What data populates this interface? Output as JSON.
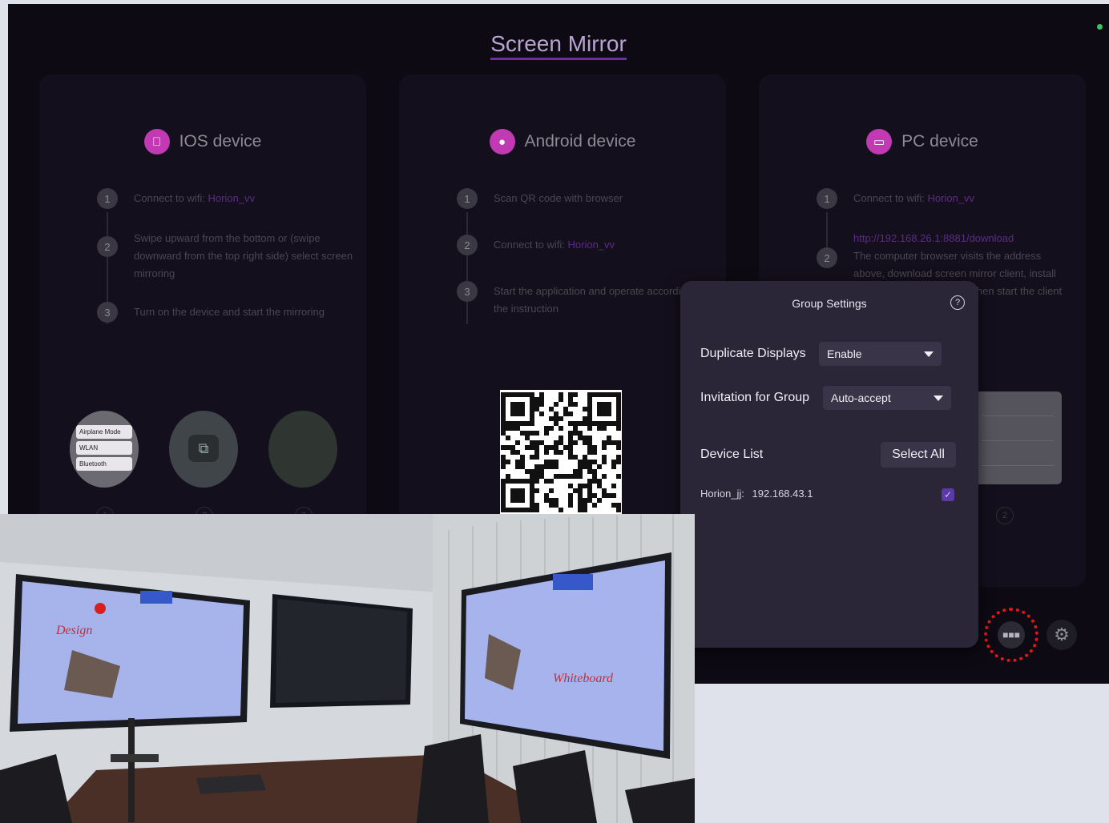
{
  "screen": {
    "title": "Screen Mirror",
    "columns": [
      {
        "name": "IOS device",
        "icon": "apple-icon",
        "steps": [
          {
            "num": "1",
            "text": "Connect to wifi:",
            "wifi": "Horion_vv"
          },
          {
            "num": "2",
            "text": "Swipe upward from the bottom or (swipe downward from the top right side) select screen mirroring"
          },
          {
            "num": "3",
            "text": "Turn on the device and start the mirroring"
          }
        ],
        "thumb_nums": [
          "1",
          "2",
          "3"
        ]
      },
      {
        "name": "Android device",
        "icon": "android-icon",
        "steps": [
          {
            "num": "1",
            "text": "Scan QR code with browser"
          },
          {
            "num": "2",
            "text": "Connect to wifi:",
            "wifi": "Horion_vv"
          },
          {
            "num": "3",
            "text": "Start the application and operate according to the instruction"
          }
        ]
      },
      {
        "name": "PC device",
        "icon": "monitor-icon",
        "steps": [
          {
            "num": "1",
            "text": "Connect to wifi:",
            "wifi": "Horion_vv"
          },
          {
            "num": "2",
            "url": "http://192.168.26.1:8881/download",
            "text": "The computer browser visits the address above, download screen mirror client, install according to the prompts, then start the client and follow the instructions"
          }
        ],
        "thumb_nums": [
          "2"
        ]
      }
    ],
    "thumbs": {
      "airplane_label": "Airplane Mode",
      "wlan_label": "WLAN",
      "bluetooth_label": "Bluetooth"
    }
  },
  "group_settings": {
    "title": "Group Settings",
    "duplicate_label": "Duplicate Displays",
    "duplicate_value": "Enable",
    "invitation_label": "Invitation for Group",
    "invitation_value": "Auto-accept",
    "device_list_label": "Device List",
    "select_all": "Select All",
    "devices": [
      {
        "name": "Horion_jj:",
        "ip": "192.168.43.1",
        "checked": true
      }
    ]
  },
  "photo": {
    "whiteboard_left_text": "Design",
    "whiteboard_right_text": "Whiteboard"
  },
  "colors": {
    "accent": "#6a2fa0",
    "brand": "#c13ab3",
    "highlight": "#e41616"
  }
}
